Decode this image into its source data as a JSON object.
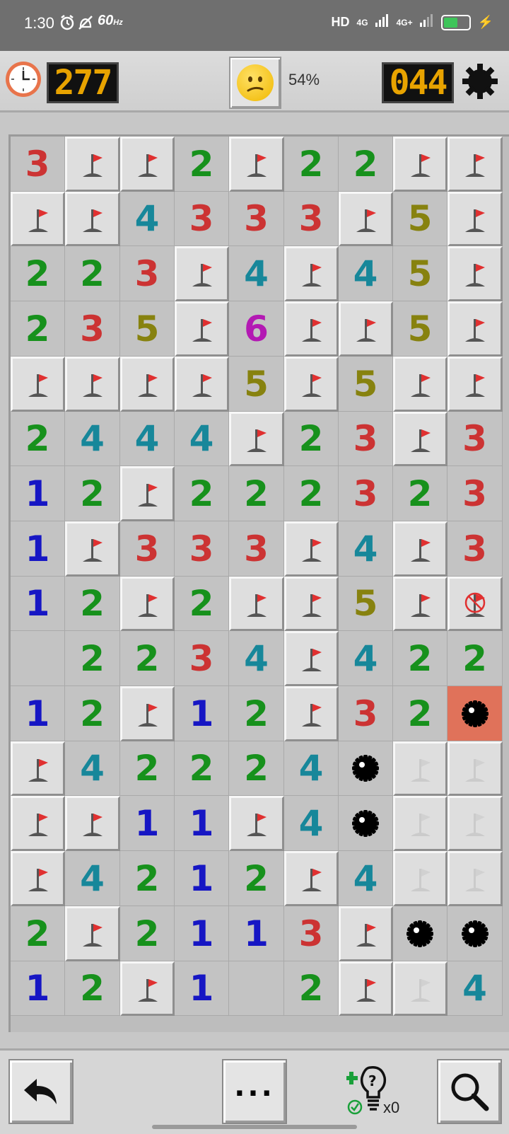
{
  "status_bar": {
    "time": "1:30",
    "refresh_rate": "60",
    "refresh_unit": "Hz",
    "network_hd": "HD",
    "network_1": "4G",
    "network_2": "4G+",
    "battery_fraction": 0.55
  },
  "header": {
    "timer": "277",
    "progress": "54%",
    "mines_left": "044",
    "smiley_state": "worried-face"
  },
  "board": {
    "cols": 9,
    "rows": 16,
    "cells": [
      [
        "3",
        "F",
        "F",
        "2",
        "F",
        "2",
        "2",
        "F",
        "F"
      ],
      [
        "F",
        "F",
        "4",
        "3",
        "3",
        "3",
        "F",
        "5",
        "F"
      ],
      [
        "2",
        "2",
        "3",
        "F",
        "4",
        "F",
        "4",
        "5",
        "F"
      ],
      [
        "2",
        "3",
        "5",
        "F",
        "6",
        "F",
        "F",
        "5",
        "F"
      ],
      [
        "F",
        "F",
        "F",
        "F",
        "5",
        "F",
        "5",
        "F",
        "F"
      ],
      [
        "2",
        "4",
        "4",
        "4",
        "F",
        "2",
        "3",
        "F",
        "3"
      ],
      [
        "1",
        "2",
        "F",
        "2",
        "2",
        "2",
        "3",
        "2",
        "3"
      ],
      [
        "1",
        "F",
        "3",
        "3",
        "3",
        "F",
        "4",
        "F",
        "3"
      ],
      [
        "1",
        "2",
        "F",
        "2",
        "F",
        "F",
        "5",
        "F",
        "X"
      ],
      [
        "",
        "2",
        "2",
        "3",
        "4",
        "F",
        "4",
        "2",
        "2"
      ],
      [
        "1",
        "2",
        "F",
        "1",
        "2",
        "F",
        "3",
        "2",
        "B"
      ],
      [
        "F",
        "4",
        "2",
        "2",
        "2",
        "4",
        "M",
        "G",
        "G"
      ],
      [
        "F",
        "F",
        "1",
        "1",
        "F",
        "4",
        "M",
        "G",
        "G"
      ],
      [
        "F",
        "4",
        "2",
        "1",
        "2",
        "F",
        "4",
        "G",
        "G"
      ],
      [
        "2",
        "F",
        "2",
        "1",
        "1",
        "3",
        "F",
        "M",
        "M"
      ],
      [
        "1",
        "2",
        "F",
        "1",
        "",
        "2",
        "F",
        "G",
        "4"
      ]
    ]
  },
  "bottom_bar": {
    "undo_icon": "undo-arrow-icon",
    "menu_label": "...",
    "hint_count": "x0",
    "zoom_icon": "magnifier-icon"
  }
}
